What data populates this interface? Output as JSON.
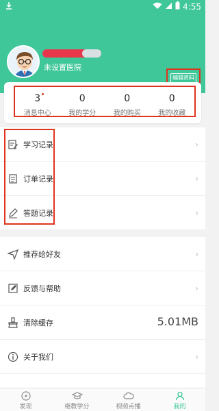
{
  "status_bar": {
    "time": "4:55"
  },
  "profile": {
    "hospital": "未设置医院",
    "edit_button": "编辑资料"
  },
  "stats": [
    {
      "value": "3",
      "label": "消息中心"
    },
    {
      "value": "0",
      "label": "我的学分"
    },
    {
      "value": "0",
      "label": "我的购买"
    },
    {
      "value": "0",
      "label": "我的收藏"
    }
  ],
  "records": [
    {
      "label": "学习记录",
      "icon": "edit-note-icon"
    },
    {
      "label": "订单记录",
      "icon": "order-list-icon"
    },
    {
      "label": "答题记录",
      "icon": "pencil-icon"
    }
  ],
  "settings": [
    {
      "label": "推荐给好友",
      "icon": "send-icon"
    },
    {
      "label": "反馈与帮助",
      "icon": "feedback-icon"
    },
    {
      "label": "清除缓存",
      "icon": "broom-icon",
      "value": "5.01MB"
    },
    {
      "label": "关于我们",
      "icon": "info-icon"
    }
  ],
  "tabs": [
    {
      "label": "发现",
      "icon": "compass-icon"
    },
    {
      "label": "继教学分",
      "icon": "graduation-cap-icon"
    },
    {
      "label": "视频点播",
      "icon": "cloud-icon"
    },
    {
      "label": "我的",
      "icon": "user-icon",
      "active": true
    }
  ],
  "colors": {
    "primary": "#3fc79a",
    "highlight": "#e0321c"
  }
}
